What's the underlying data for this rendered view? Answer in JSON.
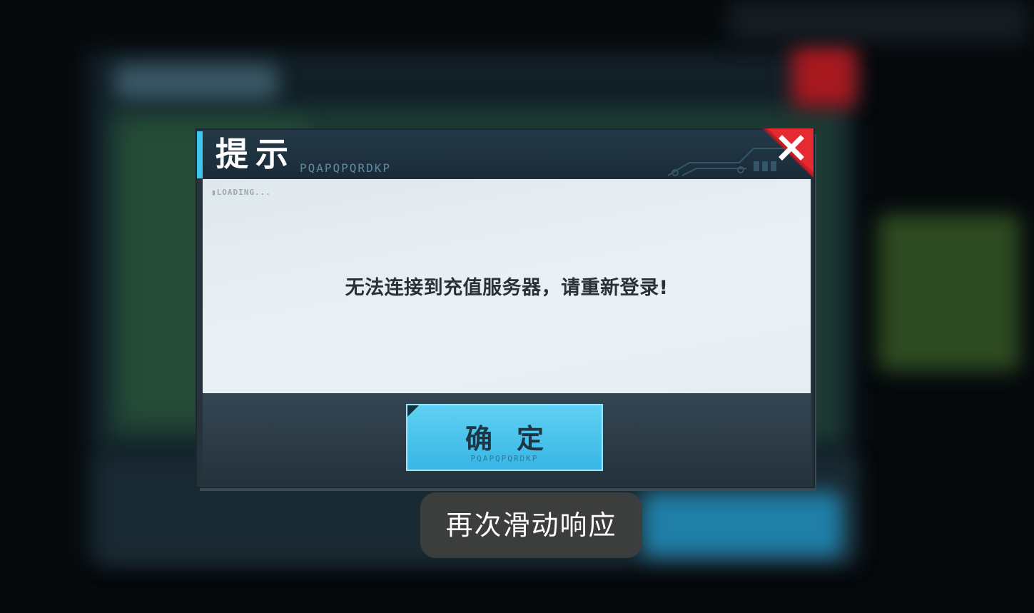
{
  "dialog": {
    "title": "提示",
    "decor_text": "PQAPQPQRDKP",
    "loading_text": "▮LOADING...",
    "message": "无法连接到充值服务器，请重新登录!",
    "ok_label": "确定",
    "ok_sub": "PQAPQPQRDKP",
    "close_icon": "close-x-icon"
  },
  "toast": {
    "text": "再次滑动响应"
  },
  "colors": {
    "accent": "#3fc6ef",
    "close_red": "#d8212a",
    "button_blue": "#38b6e6"
  }
}
